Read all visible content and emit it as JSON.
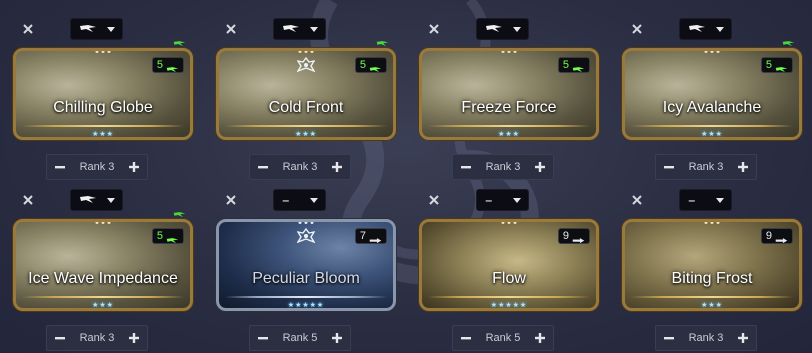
{
  "slots": [
    {
      "name": "Chilling Globe",
      "rank_label": "Rank 3",
      "drain": "5",
      "drain_polarity": "madurai-icon",
      "drain_match": true,
      "slot_polarity": "madurai-icon",
      "bonus_polarity": true,
      "frame": "gold",
      "stars": "★★★",
      "crest": false,
      "theme": "snow"
    },
    {
      "name": "Cold Front",
      "rank_label": "Rank 3",
      "drain": "5",
      "drain_polarity": "madurai-icon",
      "drain_match": true,
      "slot_polarity": "madurai-icon",
      "bonus_polarity": true,
      "frame": "gold",
      "stars": "★★★",
      "crest": true,
      "theme": "snow"
    },
    {
      "name": "Freeze Force",
      "rank_label": "Rank 3",
      "drain": "5",
      "drain_polarity": "madurai-icon",
      "drain_match": true,
      "slot_polarity": "madurai-icon",
      "bonus_polarity": false,
      "frame": "gold",
      "stars": "★★★",
      "crest": false,
      "theme": "snow"
    },
    {
      "name": "Icy Avalanche",
      "rank_label": "Rank 3",
      "drain": "5",
      "drain_polarity": "madurai-icon",
      "drain_match": true,
      "slot_polarity": "madurai-icon",
      "bonus_polarity": true,
      "frame": "gold",
      "stars": "★★★",
      "crest": false,
      "theme": "snow"
    },
    {
      "name": "Ice Wave Impedance",
      "rank_label": "Rank 3",
      "drain": "5",
      "drain_polarity": "madurai-icon",
      "drain_match": true,
      "slot_polarity": "madurai-icon",
      "bonus_polarity": true,
      "frame": "gold",
      "stars": "★★★",
      "crest": false,
      "theme": "snow"
    },
    {
      "name": "Peculiar Bloom",
      "rank_label": "Rank 5",
      "drain": "7",
      "drain_polarity": "naramon-icon",
      "drain_match": false,
      "slot_polarity": "none",
      "bonus_polarity": false,
      "frame": "silver",
      "stars": "★★★★★",
      "crest": true,
      "theme": "blue"
    },
    {
      "name": "Flow",
      "rank_label": "Rank 5",
      "drain": "9",
      "drain_polarity": "naramon-icon",
      "drain_match": false,
      "slot_polarity": "none",
      "bonus_polarity": false,
      "frame": "gold",
      "stars": "★★★★★",
      "crest": false,
      "theme": "flow"
    },
    {
      "name": "Biting Frost",
      "rank_label": "Rank 3",
      "drain": "9",
      "drain_polarity": "naramon-icon",
      "drain_match": false,
      "slot_polarity": "none",
      "bonus_polarity": false,
      "frame": "gold",
      "stars": "★★★",
      "crest": false,
      "theme": "frost"
    }
  ],
  "colors": {
    "accent_green": "#72ff4e",
    "gold": "#caa652",
    "silver": "#9aa8c0",
    "background": "#2b2e42"
  },
  "empty_polarity_label": "–"
}
